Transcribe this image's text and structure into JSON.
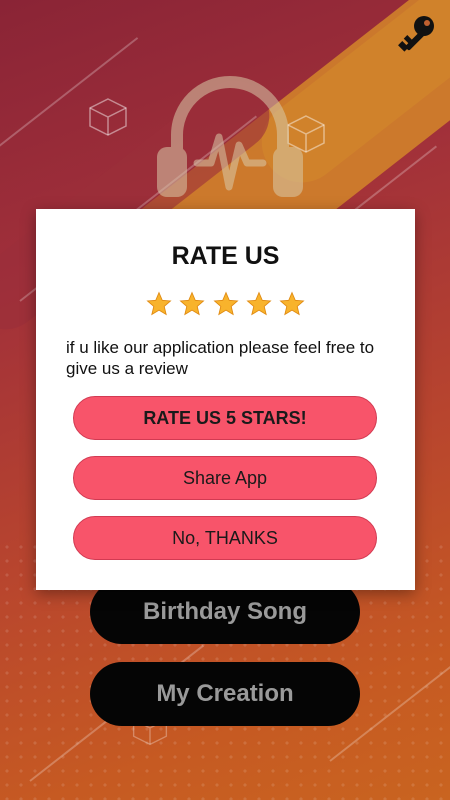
{
  "background": {
    "key_icon": "key-icon",
    "logo_icon": "headphones-icon"
  },
  "menu": {
    "birthday_song": "Birthday Song",
    "my_creation": "My Creation"
  },
  "dialog": {
    "title": "RATE US",
    "star_count": 5,
    "star_icon": "star-icon",
    "message": "if u like our application please feel free to give us a review",
    "rate_button": "RATE US 5 STARS!",
    "share_button": "Share App",
    "no_button": "No, THANKS",
    "button_color": "#f8546a"
  }
}
